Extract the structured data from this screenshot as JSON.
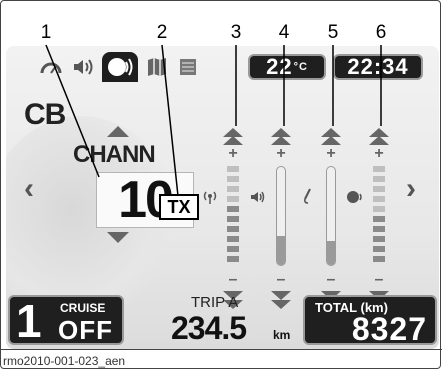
{
  "callouts": [
    "1",
    "2",
    "3",
    "4",
    "5",
    "6"
  ],
  "topbar": {
    "icons": [
      "speedometer-icon",
      "speaker-icon",
      "headset-icon",
      "map-icon",
      "list-icon"
    ],
    "active_icon": "headset-icon",
    "temperature": "22",
    "temperature_unit": "°C",
    "clock": "22:34"
  },
  "cb": {
    "mode_label": "CB",
    "channel_label": "CHANN",
    "channel_value": "10",
    "tx_label": "TX"
  },
  "levels": [
    {
      "name": "squelch",
      "icon": "antenna-icon",
      "style": "segmented",
      "level": 0.55
    },
    {
      "name": "volume",
      "icon": "speaker-icon",
      "style": "tube",
      "level": 0.3
    },
    {
      "name": "microphone",
      "icon": "microphone-icon",
      "style": "tube",
      "level": 0.25
    },
    {
      "name": "intercom",
      "icon": "headset-talk-icon",
      "style": "segmented",
      "level": 0.45
    }
  ],
  "bottom": {
    "cruise_number": "1",
    "cruise_label": "CRUISE",
    "cruise_state": "OFF",
    "trip_label": "TRIP A",
    "trip_value": "234.5",
    "trip_unit": "km",
    "total_label": "TOTAL (km)",
    "total_value": "8327"
  },
  "caption": "rmo2010-001-023_aen",
  "colors": {
    "panel_dark": "#1f1f1f",
    "screen_bg": "#eeeeee",
    "control_gray": "#666666"
  }
}
